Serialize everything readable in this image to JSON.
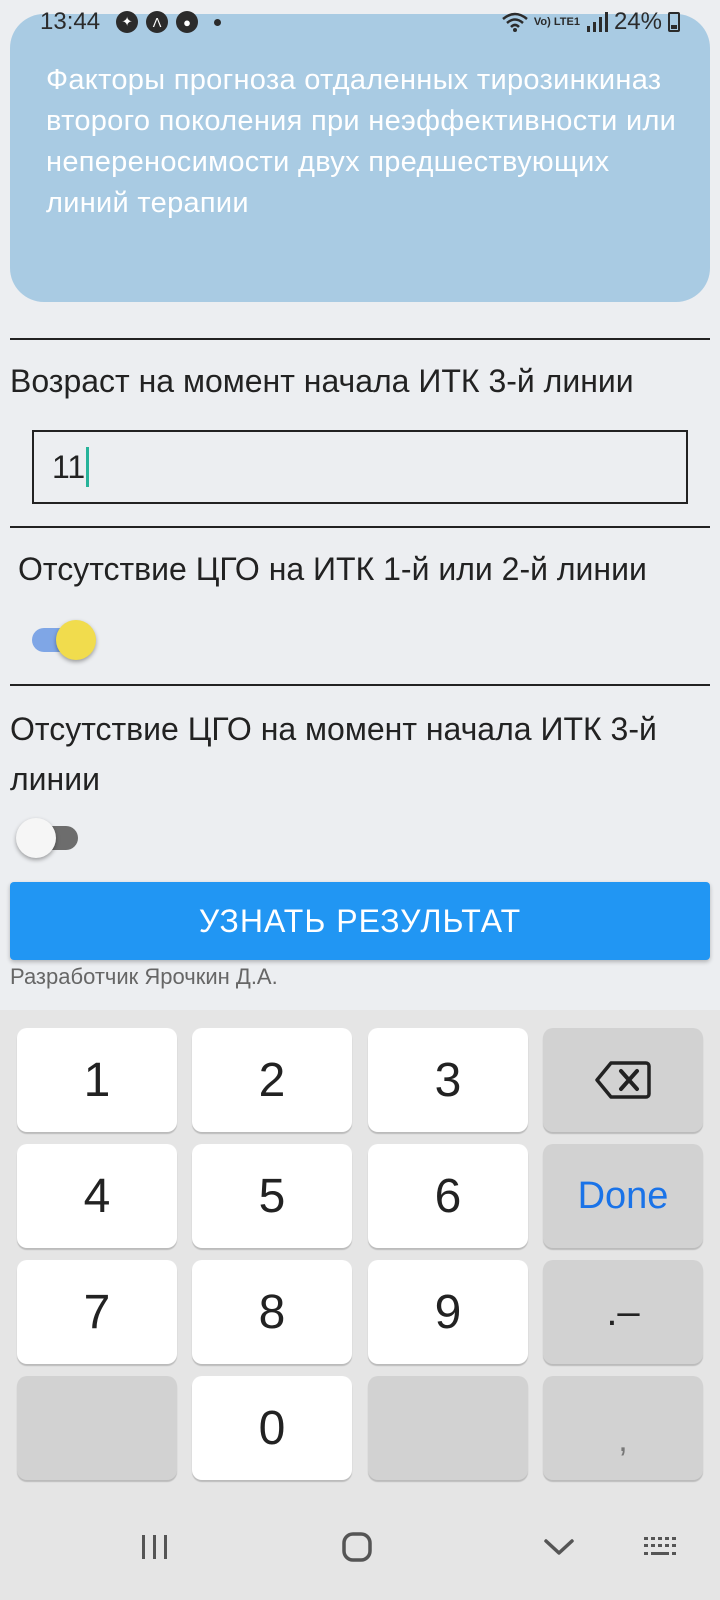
{
  "status_bar": {
    "time": "13:44",
    "network": "Vo) LTE1",
    "battery": "24%"
  },
  "header": {
    "title": "Факторы прогноза отдаленных тирозинкиназ второго поколения при неэффективности или непереносимости двух предшествующих линий терапии"
  },
  "form": {
    "age_label": "Возраст на момент начала ИТК 3-й линии",
    "age_value": "11",
    "toggle1_label": "Отсутствие ЦГО на ИТК 1-й или 2-й линии",
    "toggle1_state": "on",
    "toggle2_label": "Отсутствие ЦГО на момент начала ИТК 3-й линии",
    "toggle2_state": "off",
    "result_button": "УЗНАТЬ РЕЗУЛЬТАТ",
    "developer": "Разработчик Ярочкин Д.А."
  },
  "keyboard": {
    "keys": [
      "1",
      "2",
      "3",
      "4",
      "5",
      "6",
      "7",
      "8",
      "9",
      "0"
    ],
    "done": "Done",
    "dot_dash": ".–",
    "comma": ","
  },
  "colors": {
    "header_bg": "#a9cbe3",
    "button_bg": "#2196f3",
    "toggle_on_thumb": "#f1dc4d",
    "accent": "#1a73e8"
  }
}
